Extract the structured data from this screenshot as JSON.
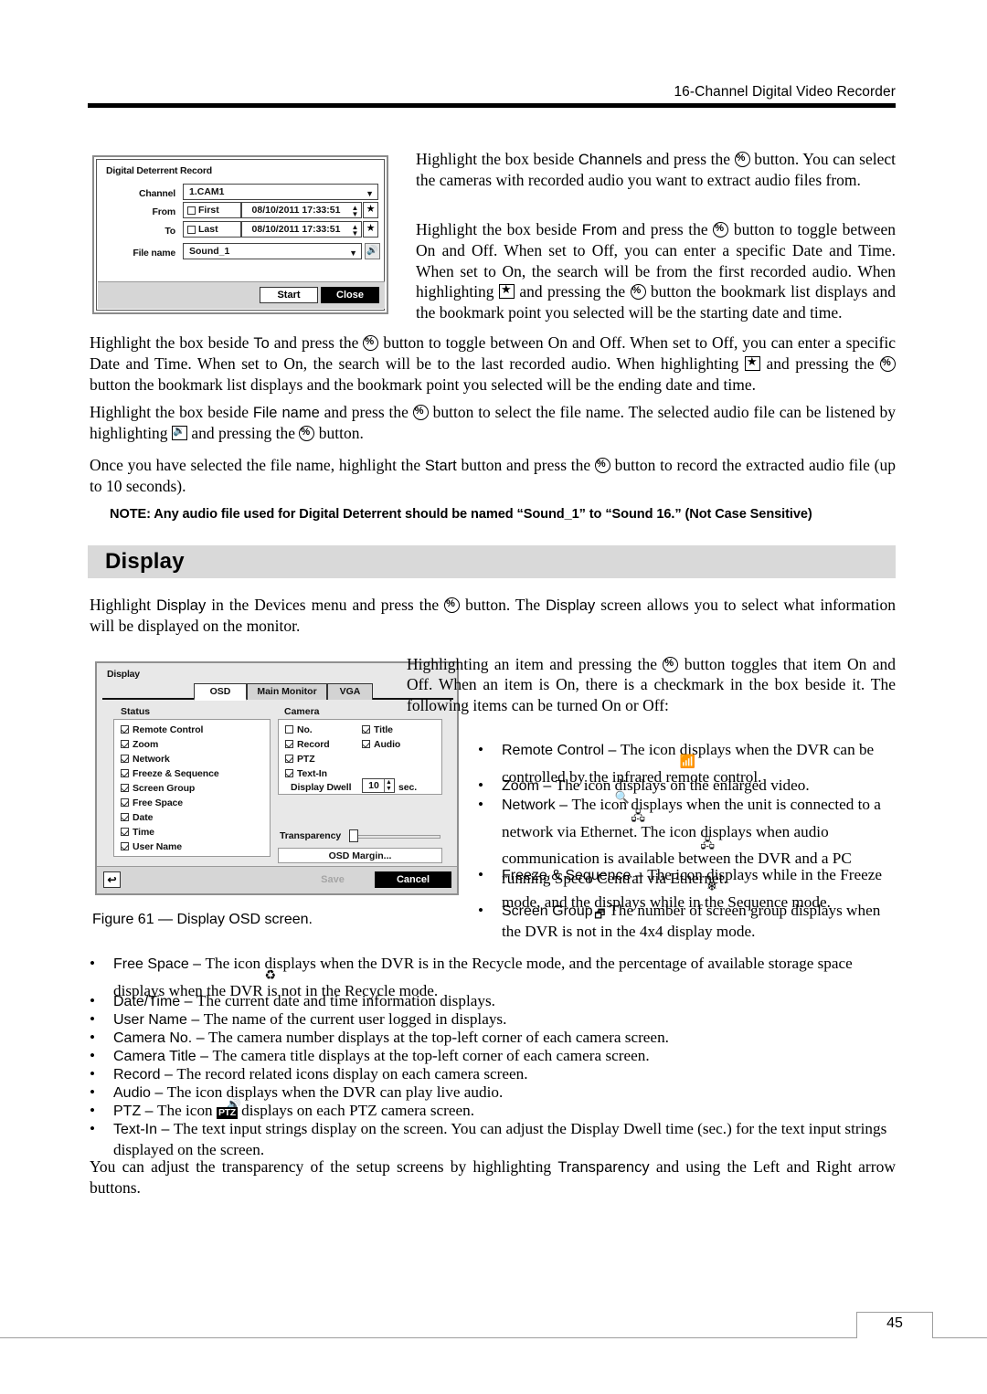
{
  "header": {
    "running_title": "16-Channel Digital Video Recorder"
  },
  "dialog_deterrent": {
    "title": "Digital Deterrent Record",
    "labels": {
      "channel": "Channel",
      "from": "From",
      "to": "To",
      "file_name": "File name"
    },
    "channel_value": "1.CAM1",
    "from_checkbox_label": "First",
    "from_datetime": "08/10/2011  17:33:51",
    "to_checkbox_label": "Last",
    "to_datetime": "08/10/2011  17:33:51",
    "file_name_value": "Sound_1",
    "star_icon": "bookmark-star-icon",
    "speaker_icon": "speaker-play-icon",
    "buttons": {
      "start": "Start",
      "close": "Close"
    }
  },
  "body": {
    "p_channels": {
      "a": "Highlight the box beside ",
      "b": "Channels",
      "c": " and press the ",
      "d": " button.  You can select the cameras with recorded audio you want to extract audio files from."
    },
    "p_from": {
      "a": "Highlight the box beside ",
      "b": "From",
      "c": " and press the ",
      "d": " button to toggle between On and Off.  When set to Off, you can enter a specific Date and Time.  When set to On, the search will be from the first recorded audio.  When highlighting ",
      "e": " and pressing the ",
      "f": " button the bookmark list displays and the bookmark point you selected will be the starting date and time."
    },
    "p_to": {
      "a": "Highlight the box beside ",
      "b": "To",
      "c": " and press the ",
      "d": " button to toggle between On and Off.  When set to Off, you can enter a specific Date and Time.  When set to On, the search will be to the last recorded audio.  When highlighting ",
      "e": " and pressing the ",
      "f": " button the bookmark list displays and the bookmark point you selected will be the ending date and time."
    },
    "p_filename": {
      "a": "Highlight the box beside ",
      "b": "File name",
      "c": " and press the ",
      "d": " button to select the file name.  The selected audio file can be listened by highlighting ",
      "e": " and pressing the ",
      "f": " button."
    },
    "p_start": {
      "a": "Once you have selected the file name, highlight the ",
      "b": "Start",
      "c": " button and press the ",
      "d": " button to record the extracted audio file (up to 10 seconds)."
    },
    "note": "NOTE:   Any audio file used for Digital Deterrent should be named “Sound_1” to “Sound 16.” (Not Case Sensitive)",
    "section_heading": "Display",
    "p_display_intro": {
      "a": "Highlight ",
      "b": "Display",
      "c": " in the Devices menu and press the ",
      "d": " button.  The ",
      "e": "Display",
      "f": " screen allows you to select what information will be displayed on the monitor."
    },
    "p_toggle": {
      "a": "Highlighting an item and pressing the ",
      "b": " button toggles that item On and Off.  When an item is On, there is a checkmark in the box beside it.  The following items can be turned On or Off:"
    },
    "p_transparency": {
      "a": "You can adjust the transparency of the setup screens by highlighting ",
      "b": "Transparency",
      "c": " and using the Left and Right arrow buttons."
    }
  },
  "figure_caption": "Figure 61 — Display OSD screen.",
  "dialog_display": {
    "title": "Display",
    "tabs": [
      {
        "label": "OSD",
        "active": true
      },
      {
        "label": "Main Monitor",
        "active": false
      },
      {
        "label": "VGA",
        "active": false
      }
    ],
    "status_group_label": "Status",
    "status_items": [
      {
        "label": "Remote Control",
        "checked": true
      },
      {
        "label": "Zoom",
        "checked": true
      },
      {
        "label": "Network",
        "checked": true
      },
      {
        "label": "Freeze & Sequence",
        "checked": true
      },
      {
        "label": "Screen Group",
        "checked": true
      },
      {
        "label": "Free Space",
        "checked": true
      },
      {
        "label": "Date",
        "checked": true
      },
      {
        "label": "Time",
        "checked": true
      },
      {
        "label": "User Name",
        "checked": true
      }
    ],
    "camera_group_label": "Camera",
    "camera_items_left": [
      {
        "label": "No.",
        "checked": false
      },
      {
        "label": "Record",
        "checked": true
      },
      {
        "label": "PTZ",
        "checked": true
      },
      {
        "label": "Text-In",
        "checked": true
      }
    ],
    "camera_items_right": [
      {
        "label": "Title",
        "checked": true
      },
      {
        "label": "Audio",
        "checked": true
      }
    ],
    "display_dwell_label": "Display Dwell",
    "display_dwell_value": "10",
    "display_dwell_unit": "sec.",
    "transparency_label": "Transparency",
    "osd_margin_button": "OSD Margin...",
    "back_icon": "back-arrow-icon",
    "buttons": {
      "save": "Save",
      "cancel": "Cancel"
    }
  },
  "bullets_right": [
    {
      "term": "Remote Control",
      "dash": " – ",
      "text_a": "The icon ",
      "icon": "remote-signal-icon",
      "text_b": " displays when the DVR can be controlled by the infrared remote control."
    },
    {
      "term": "Zoom",
      "dash": " – ",
      "text_a": "The icon ",
      "icon": "magnifier-plus-icon",
      "text_b": " displays on the enlarged video."
    },
    {
      "term": "Network",
      "dash": " – ",
      "text_a": "The icon ",
      "icon": "network-icon",
      "text_b": " displays when the unit is connected to a network via Ethernet.  The icon ",
      "icon2": "network-audio-icon",
      "text_c": " displays when audio communication is available between the DVR and a PC running Speco Central via Ethernet."
    },
    {
      "term": "Freeze & Sequence",
      "dash": " – ",
      "text_a": "The icon ",
      "icon": "freeze-snowflake-icon",
      "text_b": " displays while in the Freeze mode, and the ",
      "icon2": "sequence-icon",
      "text_c": " displays while in the Sequence mode."
    },
    {
      "term": "Screen Group",
      "dash": " – ",
      "text_a": "The number of screen group displays when the DVR is not in the 4x4 display mode."
    }
  ],
  "bullets_bottom": [
    {
      "term": "Free Space",
      "dash": " – ",
      "text_a": "The icon ",
      "icon": "recycle-icon",
      "text_b": " displays when the DVR is in the Recycle mode, and the percentage of available storage space displays when the DVR is not in the Recycle mode."
    },
    {
      "term": "Date/Time",
      "dash": " – ",
      "text_a": "The current date and time information displays."
    },
    {
      "term": "User Name",
      "dash": " – ",
      "text_a": "The name of the current user logged in displays."
    },
    {
      "term": "Camera No.",
      "dash": " – ",
      "text_a": "The camera number displays at the top-left corner of each camera screen."
    },
    {
      "term": "Camera Title",
      "dash": " – ",
      "text_a": "The camera title displays at the top-left corner of each camera screen."
    },
    {
      "term": "Record",
      "dash": " – ",
      "text_a": "The record related icons display on each camera screen."
    },
    {
      "term": "Audio",
      "dash": " – ",
      "text_a": "The icon ",
      "icon": "audio-speaker-icon",
      "text_b": " displays when the DVR can play live audio."
    },
    {
      "term": "PTZ",
      "dash": " – ",
      "text_a": "The icon ",
      "icon": "ptz-badge-icon",
      "text_b": " displays on each PTZ camera screen."
    },
    {
      "term": "Text-In",
      "dash": " – ",
      "text_a": "The text input strings display on the screen.  You can adjust the Display Dwell time (sec.) for the text input strings displayed on the screen."
    }
  ],
  "footer": {
    "page_number": "45"
  }
}
